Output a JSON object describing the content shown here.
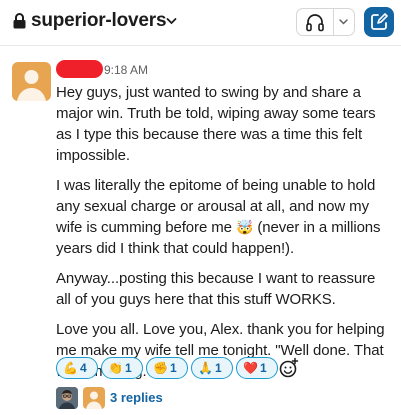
{
  "header": {
    "channel_name": "superior-lovers",
    "icons": [
      "lock-icon",
      "chevron-down-icon",
      "headphones-icon",
      "compose-icon"
    ]
  },
  "message": {
    "time": "9:18 AM",
    "paragraphs": [
      "Hey guys, just wanted to swing by and share a major win. Truth be told, wiping away some tears as I type this because there was a time this felt impossible.",
      "I was literally the epitome of being unable to hold any sexual charge or arousal at all, and now my wife is cumming before me",
      "(never in a millions years did I think that could happen!).",
      "Anyway...posting this because I want to reassure all of you guys here that this stuff WORKS.",
      "Love you all. Love you, Alex. thank you for helping me make my wife tell me tonight. \"Well done. That was amazing.\""
    ],
    "inline_emoji": "🤯"
  },
  "reactions": [
    {
      "emoji": "💪",
      "count": "4"
    },
    {
      "emoji": "👏",
      "count": "1"
    },
    {
      "emoji": "✊",
      "count": "1"
    },
    {
      "emoji": "🙏",
      "count": "1"
    },
    {
      "emoji": "❤️",
      "count": "1"
    }
  ],
  "thread": {
    "replies_label": "3 replies"
  },
  "colors": {
    "link": "#1264a3",
    "reaction_border": "#1d9bd1",
    "reaction_bg": "#e8f5fa",
    "compose_bg": "#1264a3",
    "avatar_bg": "#e7a552",
    "name_redaction": "#f0202a"
  }
}
